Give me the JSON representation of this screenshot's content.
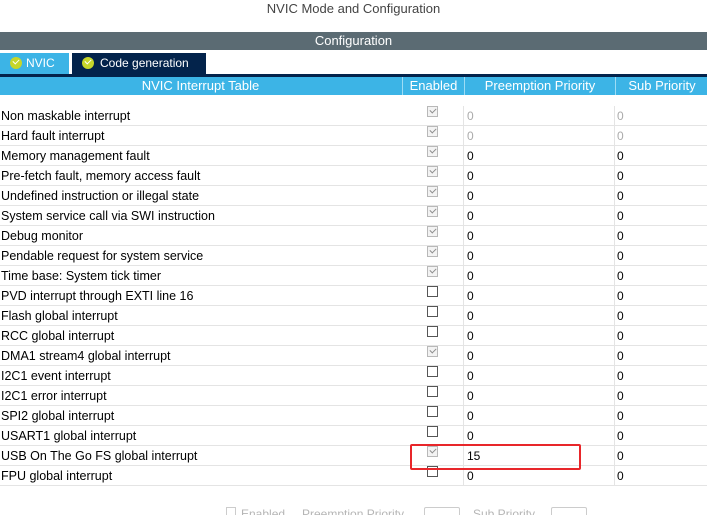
{
  "window": {
    "title": "NVIC Mode and Configuration"
  },
  "config_bar": {
    "label": "Configuration"
  },
  "tabs": [
    {
      "label": "NVIC",
      "active": false
    },
    {
      "label": "Code generation",
      "active": true
    }
  ],
  "table": {
    "headers": [
      "NVIC Interrupt Table",
      "Enabled",
      "Preemption Priority",
      "Sub Priority"
    ],
    "rows": [
      {
        "name": "Non maskable interrupt",
        "enabled": true,
        "preemption": "0",
        "sub": "0",
        "locked": true
      },
      {
        "name": "Hard fault interrupt",
        "enabled": true,
        "preemption": "0",
        "sub": "0",
        "locked": true
      },
      {
        "name": "Memory management fault",
        "enabled": true,
        "preemption": "0",
        "sub": "0",
        "locked": false
      },
      {
        "name": "Pre-fetch fault, memory access fault",
        "enabled": true,
        "preemption": "0",
        "sub": "0",
        "locked": false
      },
      {
        "name": "Undefined instruction or illegal state",
        "enabled": true,
        "preemption": "0",
        "sub": "0",
        "locked": false
      },
      {
        "name": "System service call via SWI instruction",
        "enabled": true,
        "preemption": "0",
        "sub": "0",
        "locked": false
      },
      {
        "name": "Debug monitor",
        "enabled": true,
        "preemption": "0",
        "sub": "0",
        "locked": false
      },
      {
        "name": "Pendable request for system service",
        "enabled": true,
        "preemption": "0",
        "sub": "0",
        "locked": false
      },
      {
        "name": "Time base: System tick timer",
        "enabled": true,
        "preemption": "0",
        "sub": "0",
        "locked": false
      },
      {
        "name": "PVD interrupt through EXTI line 16",
        "enabled": false,
        "preemption": "0",
        "sub": "0",
        "locked": false
      },
      {
        "name": "Flash global interrupt",
        "enabled": false,
        "preemption": "0",
        "sub": "0",
        "locked": false
      },
      {
        "name": "RCC global interrupt",
        "enabled": false,
        "preemption": "0",
        "sub": "0",
        "locked": false
      },
      {
        "name": "DMA1 stream4 global interrupt",
        "enabled": true,
        "preemption": "0",
        "sub": "0",
        "locked": false
      },
      {
        "name": "I2C1 event interrupt",
        "enabled": false,
        "preemption": "0",
        "sub": "0",
        "locked": false
      },
      {
        "name": "I2C1 error interrupt",
        "enabled": false,
        "preemption": "0",
        "sub": "0",
        "locked": false
      },
      {
        "name": "SPI2 global interrupt",
        "enabled": false,
        "preemption": "0",
        "sub": "0",
        "locked": false
      },
      {
        "name": "USART1 global interrupt",
        "enabled": false,
        "preemption": "0",
        "sub": "0",
        "locked": false
      },
      {
        "name": "USB On The Go FS global interrupt",
        "enabled": true,
        "preemption": "15",
        "sub": "0",
        "locked": false
      },
      {
        "name": "FPU global interrupt",
        "enabled": false,
        "preemption": "0",
        "sub": "0",
        "locked": false
      }
    ]
  },
  "footer": {
    "enabled_label": "Enabled",
    "preemption_label": "Preemption Priority",
    "sub_label": "Sub Priority"
  },
  "colors": {
    "accent": "#3cb4e6",
    "dark_tab": "#03234b",
    "config_bar": "#5b6b73",
    "highlight": "#e8262a"
  }
}
